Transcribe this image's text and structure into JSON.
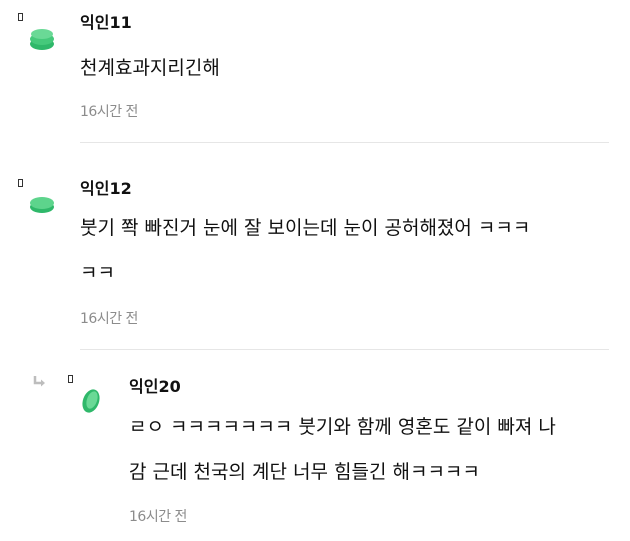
{
  "comments": [
    {
      "nickname": "익인11",
      "lines": [
        "천계효과지리긴해"
      ],
      "time": "16시간 전",
      "avatar_icon": "green-stack-avatar-icon",
      "avatar_color": "#4fcf83"
    },
    {
      "nickname": "익인12",
      "lines": [
        "붓기 쫙 빠진거 눈에 잘 보이는데 눈이 공허해졌어 ㅋㅋㅋ",
        "ㅋㅋ"
      ],
      "time": "16시간 전",
      "avatar_icon": "green-disc-avatar-icon",
      "avatar_color": "#4fcf83"
    },
    {
      "nickname": "익인20",
      "lines": [
        "ㄹㅇ ㅋㅋㅋㅋㅋㅋㅋ 붓기와 함께 영혼도 같이 빠져 나",
        "감 근데 천국의 계단 너무 힘들긴 해ㅋㅋㅋㅋ"
      ],
      "time": "16시간 전",
      "is_reply": true,
      "reply_icon": "reply-arrow-icon",
      "avatar_icon": "green-leaf-avatar-icon",
      "avatar_color": "#4fcf83"
    }
  ]
}
